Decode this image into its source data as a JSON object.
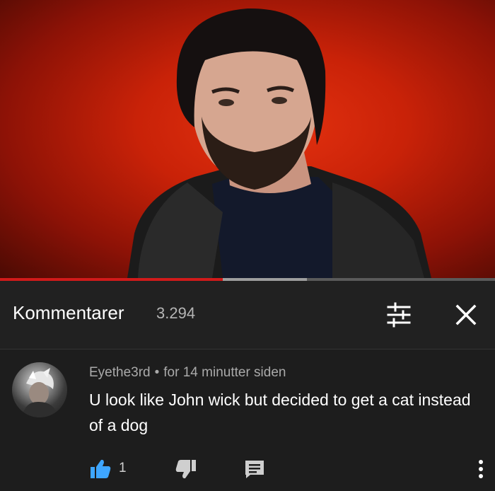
{
  "comments_panel": {
    "title": "Kommentarer",
    "count": "3.294"
  },
  "comment": {
    "author": "Eyethe3rd",
    "separator": "•",
    "time": "for 14 minutter siden",
    "text": "U look like John wick but decided to get a cat instead of a dog",
    "like_count": "1"
  },
  "player": {
    "progress_fraction": 0.45,
    "buffer_end_fraction": 0.62
  },
  "colors": {
    "accent_like": "#3ea6ff",
    "progress": "#d11a1a",
    "background": "#212121"
  },
  "icons": {
    "sort": "sort-icon",
    "close": "close-icon",
    "like": "thumbs-up-icon",
    "dislike": "thumbs-down-icon",
    "reply": "reply-icon",
    "more": "more-vert-icon"
  }
}
